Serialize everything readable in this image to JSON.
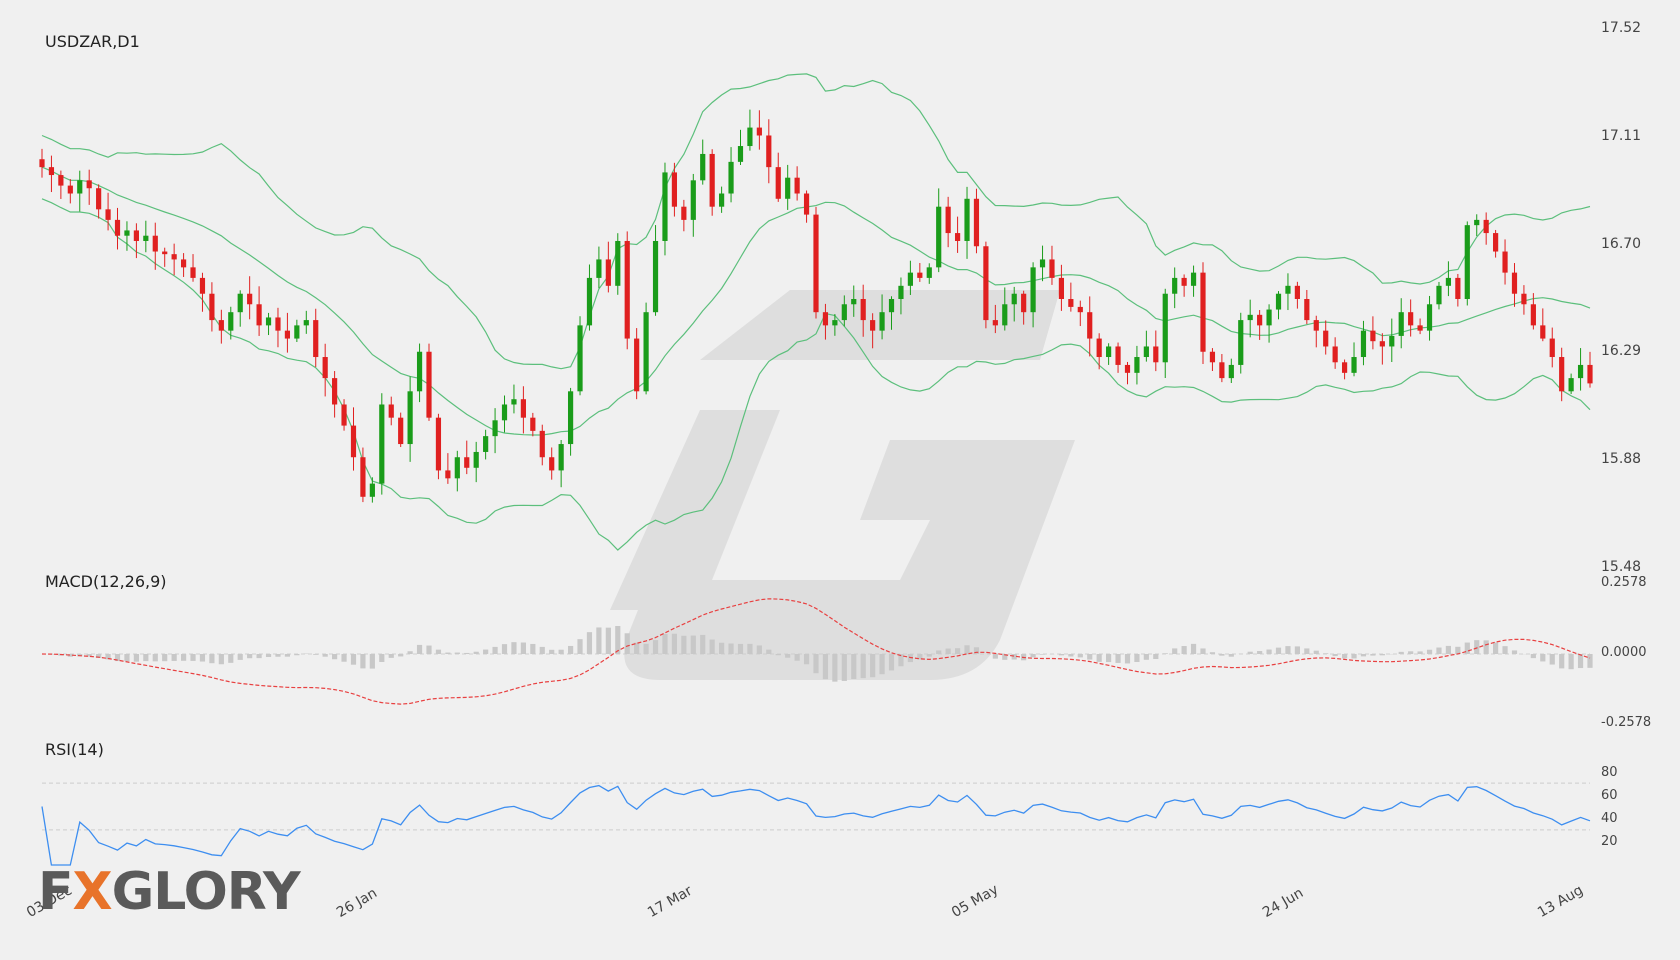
{
  "panels": {
    "price_title": "USDZAR,D1",
    "macd_title": "MACD(12,26,9)",
    "rsi_title": "RSI(14)"
  },
  "price_axis": [
    "17.52",
    "17.11",
    "16.70",
    "16.29",
    "15.88",
    "15.48"
  ],
  "macd_axis": [
    "0.2578",
    "0.0000",
    "-0.2578"
  ],
  "rsi_axis": [
    "80",
    "60",
    "40",
    "20"
  ],
  "x_axis": [
    "03 Dec",
    "26 Jan",
    "17 Mar",
    "05 May",
    "24 Jun",
    "13 Aug"
  ],
  "logo": {
    "text_a": "F",
    "text_b": "X",
    "text_c": "GLORY"
  },
  "colors": {
    "up": "#1a9c1a",
    "down": "#e02020",
    "band": "#5cbf7c",
    "macd_hist": "#c8c8c8",
    "macd_signal": "#e84040",
    "rsi": "#3d8ef0"
  },
  "chart_data": {
    "type": "line",
    "symbol": "USDZAR",
    "timeframe": "D1",
    "price_ylim": [
      15.48,
      17.52
    ],
    "close": [
      17.0,
      16.97,
      16.93,
      16.9,
      16.95,
      16.92,
      16.84,
      16.8,
      16.74,
      16.76,
      16.72,
      16.74,
      16.68,
      16.67,
      16.65,
      16.62,
      16.58,
      16.52,
      16.42,
      16.38,
      16.45,
      16.52,
      16.48,
      16.4,
      16.43,
      16.38,
      16.35,
      16.4,
      16.42,
      16.28,
      16.2,
      16.1,
      16.02,
      15.9,
      15.75,
      15.8,
      16.1,
      16.05,
      15.95,
      16.15,
      16.3,
      16.05,
      15.85,
      15.82,
      15.9,
      15.86,
      15.92,
      15.98,
      16.04,
      16.1,
      16.12,
      16.05,
      16.0,
      15.9,
      15.85,
      15.95,
      16.15,
      16.4,
      16.58,
      16.65,
      16.55,
      16.72,
      16.35,
      16.15,
      16.45,
      16.72,
      16.98,
      16.85,
      16.8,
      16.95,
      17.05,
      16.85,
      16.9,
      17.02,
      17.08,
      17.15,
      17.12,
      17.0,
      16.88,
      16.96,
      16.9,
      16.82,
      16.45,
      16.4,
      16.42,
      16.48,
      16.5,
      16.42,
      16.38,
      16.45,
      16.5,
      16.55,
      16.6,
      16.58,
      16.62,
      16.85,
      16.75,
      16.72,
      16.88,
      16.7,
      16.42,
      16.4,
      16.48,
      16.52,
      16.45,
      16.62,
      16.65,
      16.58,
      16.5,
      16.47,
      16.45,
      16.35,
      16.28,
      16.32,
      16.25,
      16.22,
      16.28,
      16.32,
      16.26,
      16.52,
      16.58,
      16.55,
      16.6,
      16.3,
      16.26,
      16.2,
      16.25,
      16.42,
      16.44,
      16.4,
      16.46,
      16.52,
      16.55,
      16.5,
      16.42,
      16.38,
      16.32,
      16.26,
      16.22,
      16.28,
      16.38,
      16.34,
      16.32,
      16.36,
      16.45,
      16.4,
      16.38,
      16.48,
      16.55,
      16.58,
      16.5,
      16.78,
      16.8,
      16.75,
      16.68,
      16.6,
      16.52,
      16.48,
      16.4,
      16.35,
      16.28,
      16.15,
      16.2,
      16.25,
      16.18
    ],
    "macd_signal_ylim": [
      -0.2578,
      0.2578
    ],
    "rsi_ylim": [
      0,
      100
    ],
    "rsi_levels": [
      30,
      70
    ]
  }
}
